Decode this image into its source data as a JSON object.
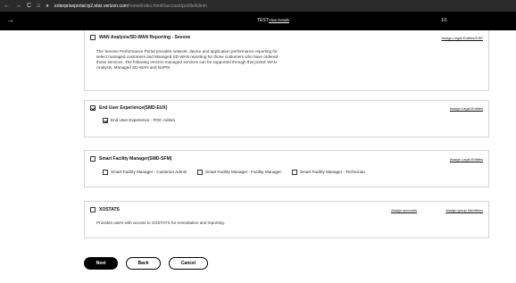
{
  "browser": {
    "back_glyph": "←",
    "forward_glyph": "→",
    "reload_glyph": "C",
    "home_glyph": "⌂",
    "lock_glyph": "⌂",
    "url_host": "enterpriseportal-ip2.ebiz.verizon.com",
    "url_path": "/home/index.html#/account/profileAdmin"
  },
  "banner": {
    "back_arrow": "→",
    "title": "TEST",
    "details_link": "View Details",
    "page_indicator": "1/1"
  },
  "sections": {
    "wan": {
      "title": "WAN Analysis/SD-WAN Reporting - Sevone",
      "checked": false,
      "link": "Assign Legal Entities/CSP",
      "description": "The Sevone Performance Portal provides network, device and application performance reporting for select managed customers and Managed SD-WAN reporting for those customers who have ordered those services. The following Verizon managed services can be supported through this portal: WAN Analysis, Managed SD-WAN and NAPM"
    },
    "eux": {
      "title": "End User Experience(SMD-EUX)",
      "checked": true,
      "link": "Assign Legal Entities",
      "sub_option": {
        "label": "End User Experience - POC-Admin",
        "checked": true
      }
    },
    "sfm": {
      "title": "Smart Facility Manager(SMD-SFM)",
      "checked": false,
      "link": "Assign Legal Entities",
      "sub_options": [
        {
          "label": "Smart Facility Manager - Customer Admin",
          "checked": false
        },
        {
          "label": "Smart Facility Manager - Facility Manager",
          "checked": false
        },
        {
          "label": "Smart Facility Manager - Technician",
          "checked": false
        }
      ]
    },
    "xostats": {
      "title": "XOSTATS",
      "checked": false,
      "link_accounts": "Assign accounts",
      "link_groups": "Assign group identifiers",
      "description": "Provides users with access to XOSTATS for remediation and reporting."
    }
  },
  "buttons": {
    "next": "Next",
    "back": "Back",
    "cancel": "Cancel"
  }
}
